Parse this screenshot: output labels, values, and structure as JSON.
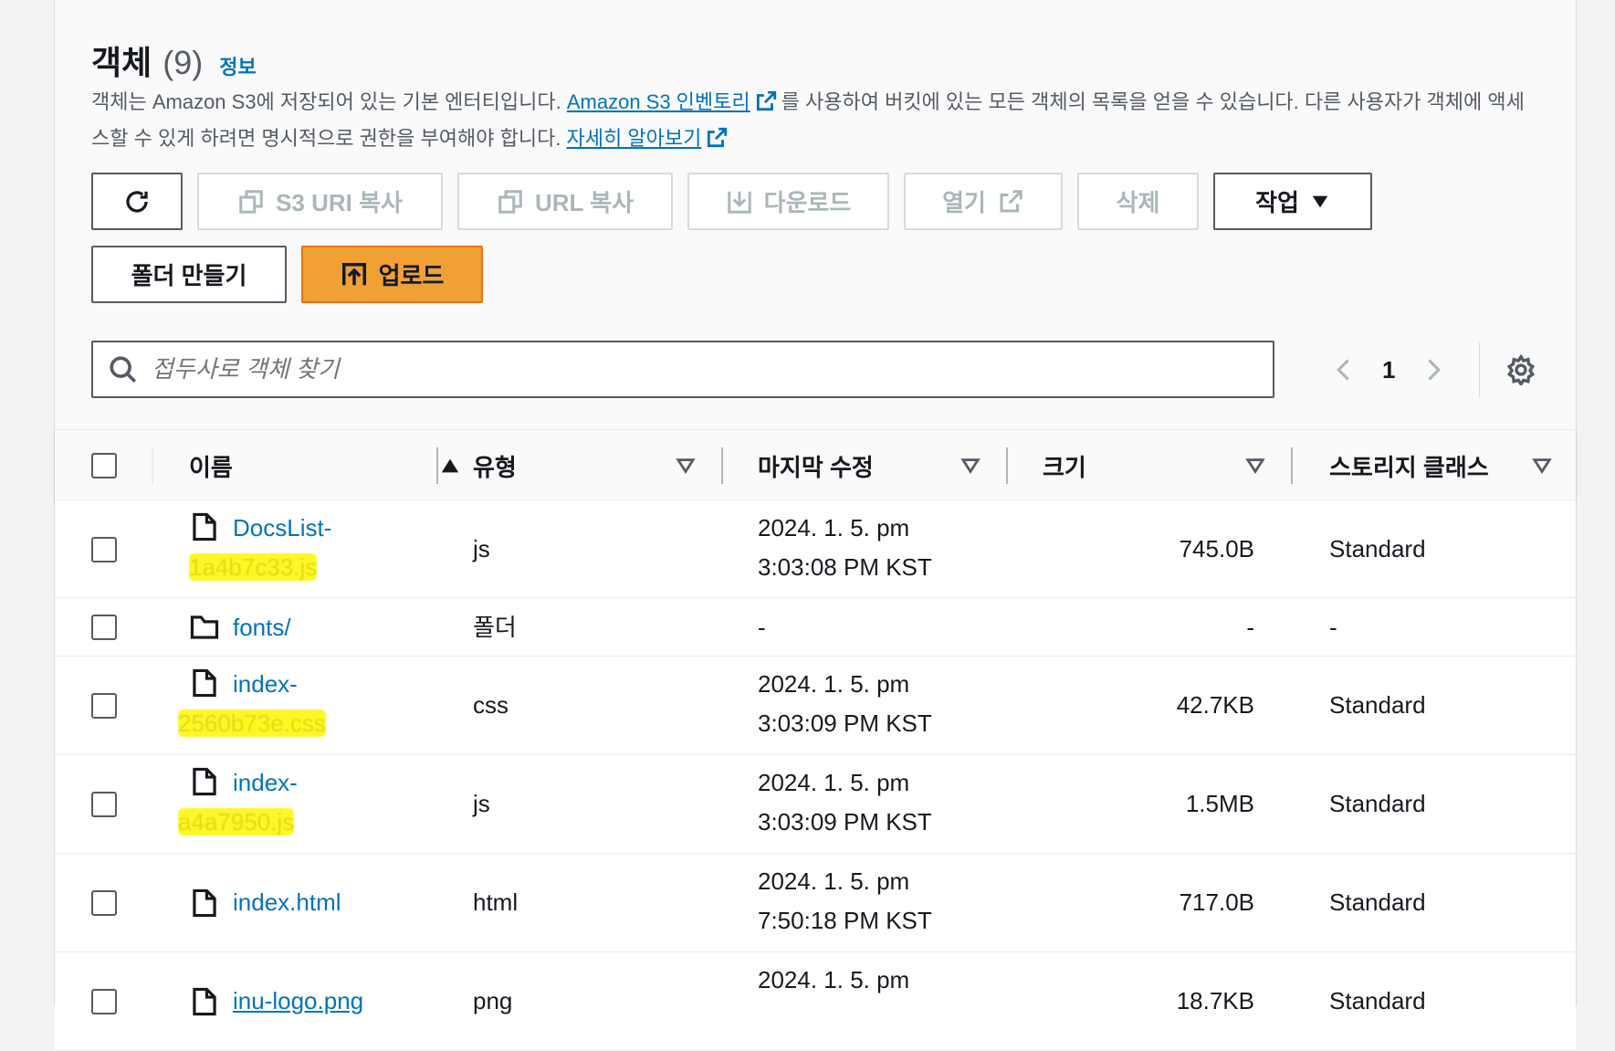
{
  "header": {
    "title": "객체",
    "count": "(9)",
    "info": "정보",
    "desc_part1": "객체는 Amazon S3에 저장되어 있는 기본 엔터티입니다. ",
    "inventory_link": "Amazon S3 인벤토리",
    "desc_part2": "를 사용하여 버킷에 있는 모든 객체의 목록을 얻을 수 있습니다. 다른 사용자가 객체에 액세스할 수 있게 하려면 명시적으로 권한을 부여해야 합니다. ",
    "learn_more": "자세히 알아보기"
  },
  "toolbar": {
    "copy_s3_uri": "S3 URI 복사",
    "copy_url": "URL 복사",
    "download": "다운로드",
    "open": "열기",
    "delete": "삭제",
    "actions": "작업",
    "create_folder": "폴더 만들기",
    "upload": "업로드"
  },
  "search": {
    "placeholder": "접두사로 객체 찾기"
  },
  "pagination": {
    "page": "1"
  },
  "columns": {
    "name": "이름",
    "type": "유형",
    "modified": "마지막 수정",
    "size": "크기",
    "storage": "스토리지 클래스"
  },
  "rows": [
    {
      "name1": "DocsList-",
      "name2": "1a4b7c33.js",
      "type": "js",
      "date1": "2024. 1. 5. pm",
      "date2": "3:03:08 PM KST",
      "size": "745.0B",
      "storage": "Standard",
      "icon": "file-icon"
    },
    {
      "name1": "fonts/",
      "name2": "",
      "type": "폴더",
      "date1": "-",
      "date2": "",
      "size": "-",
      "storage": "-",
      "icon": "folder-icon"
    },
    {
      "name1": "index-",
      "name2": "2560b73e.css",
      "type": "css",
      "date1": "2024. 1. 5. pm",
      "date2": "3:03:09 PM KST",
      "size": "42.7KB",
      "storage": "Standard",
      "icon": "file-icon"
    },
    {
      "name1": "index-",
      "name2": "a4a7950.js",
      "type": "js",
      "date1": "2024. 1. 5. pm",
      "date2": "3:03:09 PM KST",
      "size": "1.5MB",
      "storage": "Standard",
      "icon": "file-icon"
    },
    {
      "name1": "index.html",
      "name2": "",
      "type": "html",
      "date1": "2024. 1. 5. pm",
      "date2": "7:50:18 PM KST",
      "size": "717.0B",
      "storage": "Standard",
      "icon": "file-icon"
    },
    {
      "name1": "inu-logo.png",
      "name2": "",
      "type": "png",
      "date1": "2024. 1. 5. pm",
      "date2": "",
      "size": "18.7KB",
      "storage": "Standard",
      "icon": "file-icon"
    }
  ]
}
